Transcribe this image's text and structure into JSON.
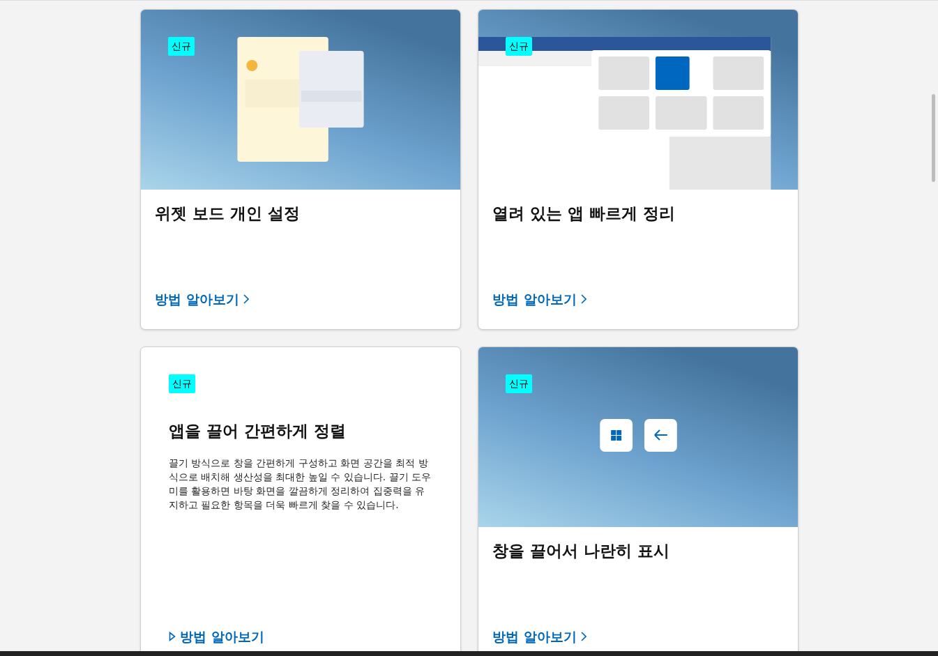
{
  "cards": [
    {
      "kind": "picture",
      "badge": "신규",
      "title": "위젯 보드 개인 설정",
      "link": "방법 알아보기"
    },
    {
      "kind": "picture",
      "badge": "신규",
      "title": "열려 있는 앱 빠르게 정리",
      "link": "방법 알아보기"
    },
    {
      "kind": "text",
      "badge": "신규",
      "title": "앱을 끌어 간편하게 정렬",
      "description": "끌기 방식으로 창을 간편하게 구성하고 화면 공간을 최적 방식으로 배치해 생산성을 최대한 높일 수 있습니다. 끌기 도우미를 활용하면 바탕 화면을 깔끔하게 정리하여 집중력을 유지하고 필요한 항목을 더욱 빠르게 찾을 수 있습니다.",
      "link": "방법 알아보기"
    },
    {
      "kind": "picture",
      "badge": "신규",
      "title": "창을 끌어서 나란히 표시",
      "link": "방법 알아보기"
    }
  ]
}
